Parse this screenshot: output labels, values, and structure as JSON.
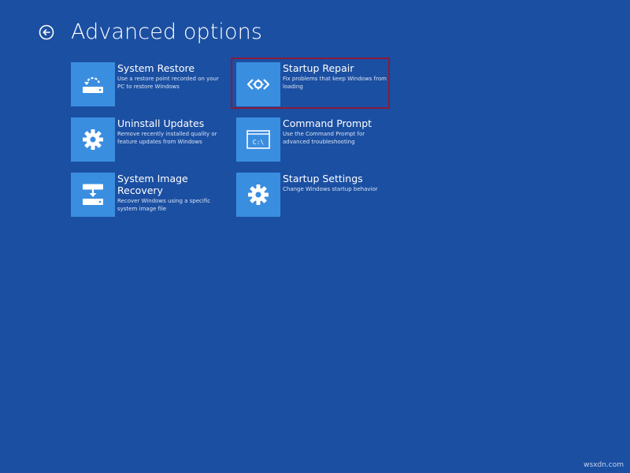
{
  "header": {
    "title": "Advanced options"
  },
  "tiles": [
    {
      "title": "System Restore",
      "description": "Use a restore point recorded on your PC to restore Windows",
      "icon": "system-restore-icon"
    },
    {
      "title": "Startup Repair",
      "description": "Fix problems that keep Windows from loading",
      "icon": "startup-repair-icon"
    },
    {
      "title": "Uninstall Updates",
      "description": "Remove recently installed quality or feature updates from Windows",
      "icon": "gear-icon"
    },
    {
      "title": "Command Prompt",
      "description": "Use the Command Prompt for advanced troubleshooting",
      "icon": "command-prompt-icon",
      "icon_text": "C:\\"
    },
    {
      "title": "System Image Recovery",
      "description": "Recover Windows using a specific system image file",
      "icon": "system-image-icon"
    },
    {
      "title": "Startup Settings",
      "description": "Change Windows startup behavior",
      "icon": "gear-icon"
    }
  ],
  "watermark": "wsxdn.com",
  "colors": {
    "background": "#1b4fa2",
    "tile": "#3a8ee0",
    "highlight_border": "#8b1a3a"
  }
}
